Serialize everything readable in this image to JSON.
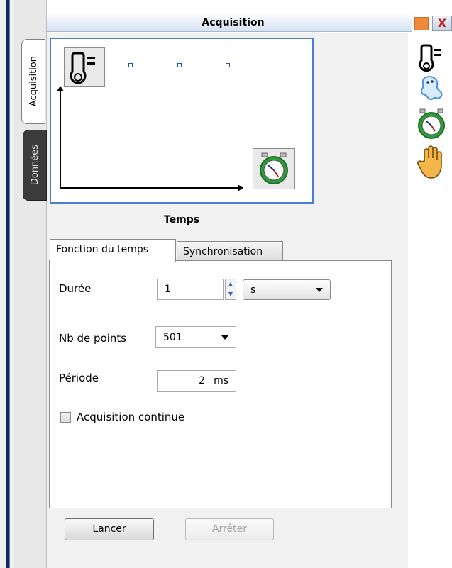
{
  "window": {
    "title": "Acquisition",
    "close_glyph": "X"
  },
  "side_tabs": [
    {
      "label": "Acquisition"
    },
    {
      "label": "Données"
    }
  ],
  "preview": {
    "x_axis_label": "Temps",
    "sensor_icon": "thermometer-icon",
    "time_icon": "stopwatch-icon",
    "placeholder_count": 3
  },
  "tabs": [
    {
      "label": "Fonction du temps",
      "active": true
    },
    {
      "label": "Synchronisation",
      "active": false
    }
  ],
  "form": {
    "duree_label": "Durée",
    "duree_value": "1",
    "duree_unit": "s",
    "nbpoints_label": "Nb de points",
    "nbpoints_value": "501",
    "periode_label": "Période",
    "periode_value": "2",
    "periode_unit": "ms",
    "continue_label": "Acquisition continue",
    "continue_checked": false
  },
  "buttons": {
    "start": "Lancer",
    "stop": "Arrêter"
  },
  "right_toolbar": [
    {
      "icon": "thermometer-icon"
    },
    {
      "icon": "ghost-icon"
    },
    {
      "icon": "stopwatch-icon"
    },
    {
      "icon": "hand-icon"
    }
  ]
}
